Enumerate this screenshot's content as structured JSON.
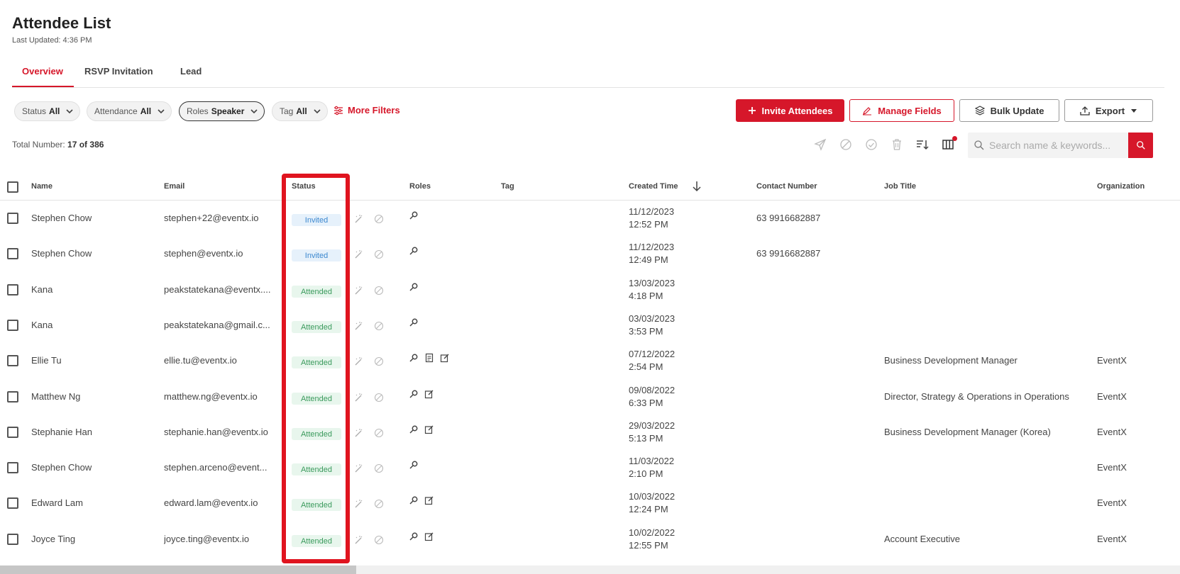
{
  "header": {
    "title": "Attendee List",
    "last_updated": "Last Updated: 4:36 PM"
  },
  "tabs": [
    {
      "label": "Overview",
      "active": true
    },
    {
      "label": "RSVP Invitation",
      "active": false
    },
    {
      "label": "Lead",
      "active": false
    }
  ],
  "filters": [
    {
      "label": "Status",
      "value": "All",
      "selected": false
    },
    {
      "label": "Attendance",
      "value": "All",
      "selected": false
    },
    {
      "label": "Roles",
      "value": "Speaker",
      "selected": true
    },
    {
      "label": "Tag",
      "value": "All",
      "selected": false
    }
  ],
  "more_filters_label": "More Filters",
  "actions": {
    "invite": "Invite Attendees",
    "manage_fields": "Manage Fields",
    "bulk_update": "Bulk Update",
    "export": "Export"
  },
  "total": {
    "label": "Total Number:",
    "value": "17 of 386"
  },
  "search": {
    "placeholder": "Search name & keywords..."
  },
  "columns": [
    "Name",
    "Email",
    "Status",
    "Roles",
    "Tag",
    "Created Time",
    "Contact Number",
    "Job Title",
    "Organization"
  ],
  "rows": [
    {
      "name": "Stephen Chow",
      "email": "stephen+22@eventx.io",
      "status": "Invited",
      "role_icons": [
        "speaker-icon"
      ],
      "date": "11/12/2023",
      "time": "12:52 PM",
      "contact": "63 9916682887",
      "job_title": "",
      "organization": ""
    },
    {
      "name": "Stephen Chow",
      "email": "stephen@eventx.io",
      "status": "Invited",
      "role_icons": [
        "speaker-icon"
      ],
      "date": "11/12/2023",
      "time": "12:49 PM",
      "contact": "63 9916682887",
      "job_title": "",
      "organization": ""
    },
    {
      "name": "Kana",
      "email": "peakstatekana@eventx....",
      "status": "Attended",
      "role_icons": [
        "speaker-icon"
      ],
      "date": "13/03/2023",
      "time": "4:18 PM",
      "contact": "",
      "job_title": "",
      "organization": ""
    },
    {
      "name": "Kana",
      "email": "peakstatekana@gmail.c...",
      "status": "Attended",
      "role_icons": [
        "speaker-icon"
      ],
      "date": "03/03/2023",
      "time": "3:53 PM",
      "contact": "",
      "job_title": "",
      "organization": ""
    },
    {
      "name": "Ellie Tu",
      "email": "ellie.tu@eventx.io",
      "status": "Attended",
      "role_icons": [
        "speaker-icon",
        "document-icon",
        "edit-icon"
      ],
      "date": "07/12/2022",
      "time": "2:54 PM",
      "contact": "",
      "job_title": "Business Development Manager",
      "organization": "EventX"
    },
    {
      "name": "Matthew Ng",
      "email": "matthew.ng@eventx.io",
      "status": "Attended",
      "role_icons": [
        "speaker-icon",
        "edit-icon"
      ],
      "date": "09/08/2022",
      "time": "6:33 PM",
      "contact": "",
      "job_title": "Director, Strategy & Operations in Operations",
      "organization": "EventX"
    },
    {
      "name": "Stephanie Han",
      "email": "stephanie.han@eventx.io",
      "status": "Attended",
      "role_icons": [
        "speaker-icon",
        "edit-icon"
      ],
      "date": "29/03/2022",
      "time": "5:13 PM",
      "contact": "",
      "job_title": "Business Development Manager (Korea)",
      "organization": "EventX"
    },
    {
      "name": "Stephen Chow",
      "email": "stephen.arceno@event...",
      "status": "Attended",
      "role_icons": [
        "speaker-icon"
      ],
      "date": "11/03/2022",
      "time": "2:10 PM",
      "contact": "",
      "job_title": "",
      "organization": "EventX"
    },
    {
      "name": "Edward Lam",
      "email": "edward.lam@eventx.io",
      "status": "Attended",
      "role_icons": [
        "speaker-icon",
        "edit-icon"
      ],
      "date": "10/03/2022",
      "time": "12:24 PM",
      "contact": "",
      "job_title": "",
      "organization": "EventX"
    },
    {
      "name": "Joyce Ting",
      "email": "joyce.ting@eventx.io",
      "status": "Attended",
      "role_icons": [
        "speaker-icon",
        "edit-icon"
      ],
      "date": "10/02/2022",
      "time": "12:55 PM",
      "contact": "",
      "job_title": "Account Executive",
      "organization": "EventX"
    }
  ],
  "colors": {
    "accent": "#d6172a",
    "invited_bg": "#e6f1fb",
    "invited_text": "#3b87cf",
    "attended_bg": "#e8f6ed",
    "attended_text": "#3a9a5c",
    "highlight": "#e0141f"
  }
}
